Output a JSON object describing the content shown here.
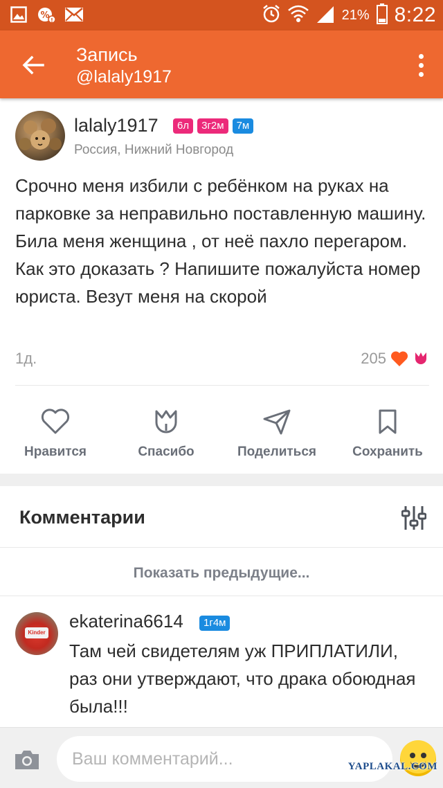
{
  "status_bar": {
    "icons": [
      "gallery-icon",
      "notification-icon",
      "mail-icon",
      "alarm-icon",
      "wifi-icon",
      "signal-icon",
      "battery-icon"
    ],
    "battery": "21%",
    "time": "8:22"
  },
  "app_bar": {
    "title": "Запись",
    "subtitle": "@lalaly1917",
    "background": "#ee6830"
  },
  "post": {
    "username": "lalaly1917",
    "badges": [
      "6л",
      "3г2м",
      "7м"
    ],
    "badge_colors": [
      "#ec2a7a",
      "#ec2a7a",
      "#1a8be0"
    ],
    "location": "Россия, Нижний Новгород",
    "text": "Срочно меня избили с ребёнком на руках на парковке за неправильно поставленную машину. Била меня женщина , от неё пахло перегаром. Как это доказать ? Напишите пожалуйста номер юриста. Везут меня на скорой",
    "age": "1д.",
    "likes": "205"
  },
  "actions": {
    "like": "Нравится",
    "thanks": "Спасибо",
    "share": "Поделиться",
    "save": "Сохранить"
  },
  "comments": {
    "title": "Комментарии",
    "show_previous": "Показать предыдущие...",
    "items": [
      {
        "username": "ekaterina6614",
        "badge": "1г4м",
        "avatar_label": "Kinder",
        "text": "Там чей свидетелям уж ПРИПЛАТИЛИ, раз они утверждают, что драка обоюдная была!!!"
      }
    ]
  },
  "composer": {
    "placeholder": "Ваш комментарий..."
  },
  "watermark": "YAPLAKAL.COM"
}
